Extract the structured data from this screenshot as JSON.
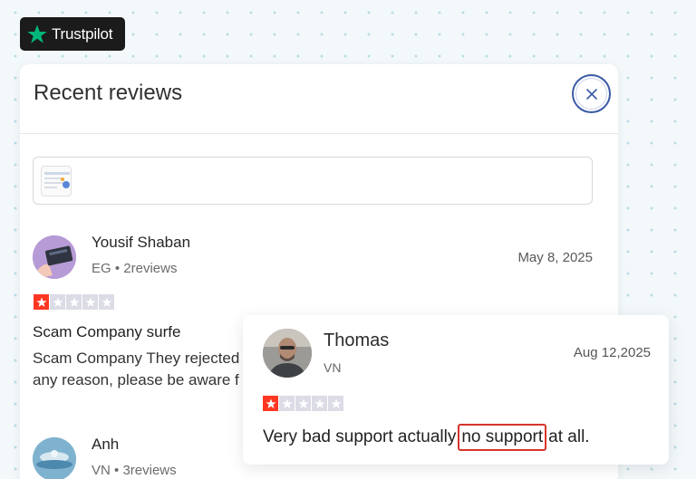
{
  "brand": {
    "name": "Trustpilot",
    "icon": "star-icon",
    "color": "#00b67a"
  },
  "panel": {
    "title": "Recent reviews",
    "close_icon": "close-icon"
  },
  "reviews": [
    {
      "name": "Yousif Shaban",
      "country": "EG",
      "reviews_count": "2reviews",
      "date": "May 8, 2025",
      "rating": 1,
      "title": "Scam Company surfe",
      "body": "Scam Company They rejected any reason, please be aware f"
    },
    {
      "name": "Anh",
      "country": "VN",
      "reviews_count": "3reviews"
    }
  ],
  "popup": {
    "name": "Thomas",
    "country": "VN",
    "date": "Aug 12,2025",
    "rating": 1,
    "text_before": "Very bad support actually",
    "text_highlight": "no support",
    "text_after": "at all."
  },
  "colors": {
    "star_active": "#ff3722",
    "star_inactive": "#dcdce6",
    "highlight_border": "#d7342e",
    "close_ring": "#3b5ba7"
  }
}
